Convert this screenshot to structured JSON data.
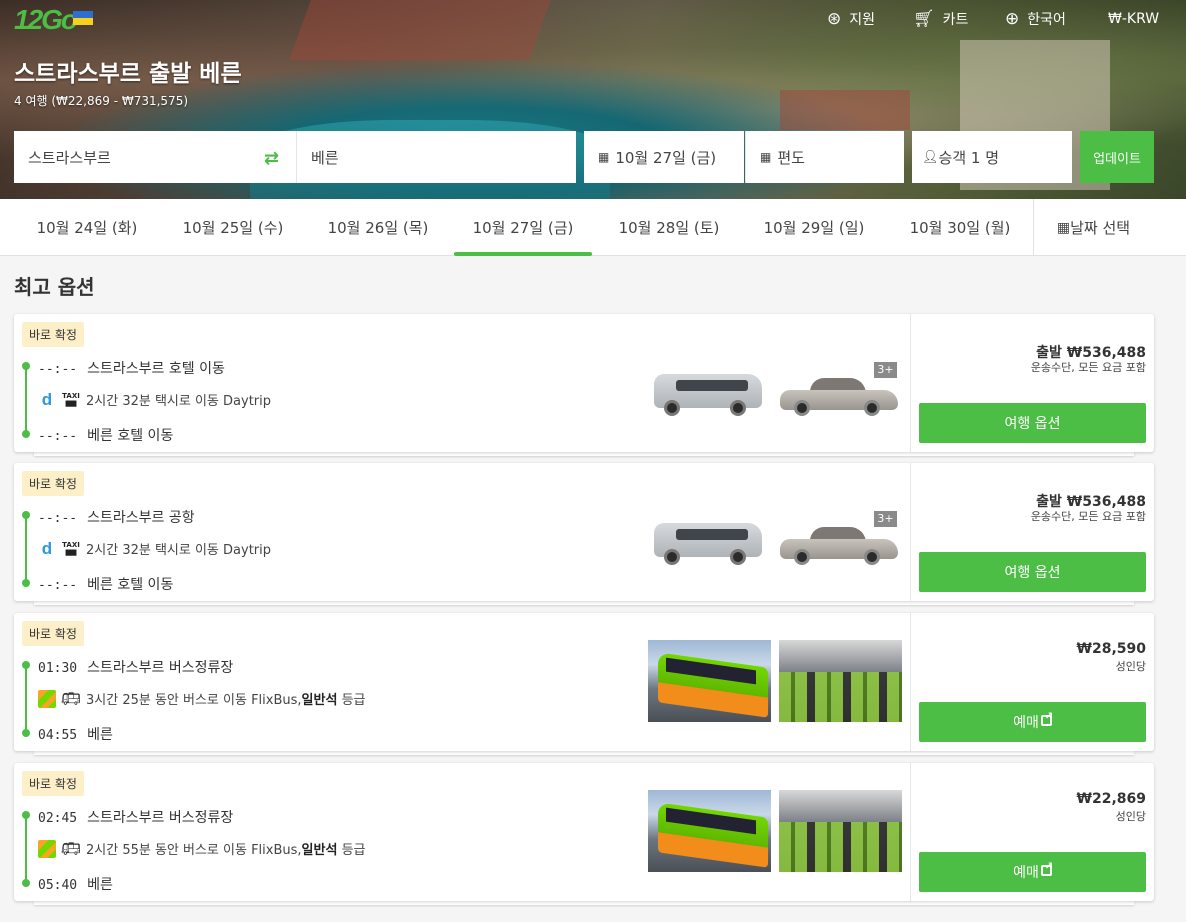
{
  "brand": {
    "logo_text": "12Go",
    "accent": "#4cbd45"
  },
  "nav": {
    "support": "지원",
    "cart": "카트",
    "language": "한국어",
    "currency": "₩-KRW"
  },
  "hero": {
    "title": "스트라스부르 출발 베른",
    "subtitle": "4 여행 (₩22,869 - ₩731,575)"
  },
  "search": {
    "from": "스트라스부르",
    "to": "베른",
    "date": "10월 27일 (금)",
    "return": "편도",
    "passengers": "승객 1 명",
    "update_label": "업데이트"
  },
  "dates": {
    "tabs": [
      "10월 24일 (화)",
      "10월 25일 (수)",
      "10월 26일 (목)",
      "10월 27일 (금)",
      "10월 28일 (토)",
      "10월 29일 (일)",
      "10월 30일 (월)"
    ],
    "active_index": 3,
    "pick_label": "날짜 선택"
  },
  "section_title": "최고 옵션",
  "results": [
    {
      "badge": "바로 확정",
      "dep_time": "--:--",
      "dep_place": "스트라스부르 호텔 이동",
      "duration": "2시간 32분 택시로 이동 Daytrip",
      "arr_time": "--:--",
      "arr_place": "베른 호텔 이동",
      "type": "taxi",
      "plus": "3+",
      "price": "출발 ₩536,488",
      "price_note": "운송수단, 모든 요금 포함",
      "cta": "여행 옵션"
    },
    {
      "badge": "바로 확정",
      "dep_time": "--:--",
      "dep_place": "스트라스부르 공항",
      "duration": "2시간 32분 택시로 이동 Daytrip",
      "arr_time": "--:--",
      "arr_place": "베른 호텔 이동",
      "type": "taxi",
      "plus": "3+",
      "price": "출발 ₩536,488",
      "price_note": "운송수단, 모든 요금 포함",
      "cta": "여행 옵션"
    },
    {
      "badge": "바로 확정",
      "dep_time": "01:30",
      "dep_place": "스트라스부르 버스정류장",
      "duration": "3시간 25분 동안 버스로 이동 FlixBus,",
      "class_label": "일반석",
      "class_suffix": "등급",
      "arr_time": "04:55",
      "arr_place": "베른",
      "type": "bus",
      "price": "₩28,590",
      "price_note": "성인당",
      "cta": "예매"
    },
    {
      "badge": "바로 확정",
      "dep_time": "02:45",
      "dep_place": "스트라스부르 버스정류장",
      "duration": "2시간 55분 동안 버스로 이동 FlixBus,",
      "class_label": "일반석",
      "class_suffix": "등급",
      "arr_time": "05:40",
      "arr_place": "베른",
      "type": "bus",
      "price": "₩22,869",
      "price_note": "성인당",
      "cta": "예매"
    }
  ]
}
